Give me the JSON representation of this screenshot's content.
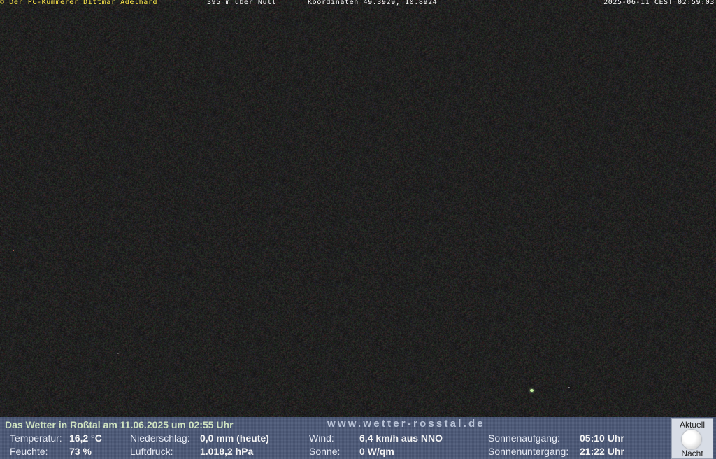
{
  "overlay": {
    "copyright": "© Der PC-Kümmerer Dittmar Adelhard",
    "altitude": "395 m über Null",
    "coordinates": "Koordinaten 49.3929, 10.8924",
    "datetime": "2025-06-11 CEST 02:59:03"
  },
  "weather": {
    "title": "Das Wetter in Roßtal am 11.06.2025 um 02:55 Uhr",
    "url": "www.wetter-rosstal.de",
    "temperatur_label": "Temperatur:",
    "temperatur_value": "16,2 °C",
    "feuchte_label": "Feuchte:",
    "feuchte_value": "73 %",
    "niederschlag_label": "Niederschlag:",
    "niederschlag_value": "0,0 mm (heute)",
    "luftdruck_label": "Luftdruck:",
    "luftdruck_value": "1.018,2 hPa",
    "wind_label": "Wind:",
    "wind_value": "6,4 km/h aus NNO",
    "sonne_label": "Sonne:",
    "sonne_value": "0 W/qm",
    "sonnenaufgang_label": "Sonnenaufgang:",
    "sonnenaufgang_value": "05:10 Uhr",
    "sonnenuntergang_label": "Sonnenuntergang:",
    "sonnenuntergang_value": "21:22 Uhr"
  },
  "moon": {
    "top_label": "Aktuell",
    "bottom_label": "Nacht",
    "icon": "moon-icon"
  },
  "colors": {
    "overlay_text": "#ffffff",
    "copyright_text": "#ffe94a",
    "bar_background": "#4b5877",
    "title_text": "#cfe3c1"
  }
}
